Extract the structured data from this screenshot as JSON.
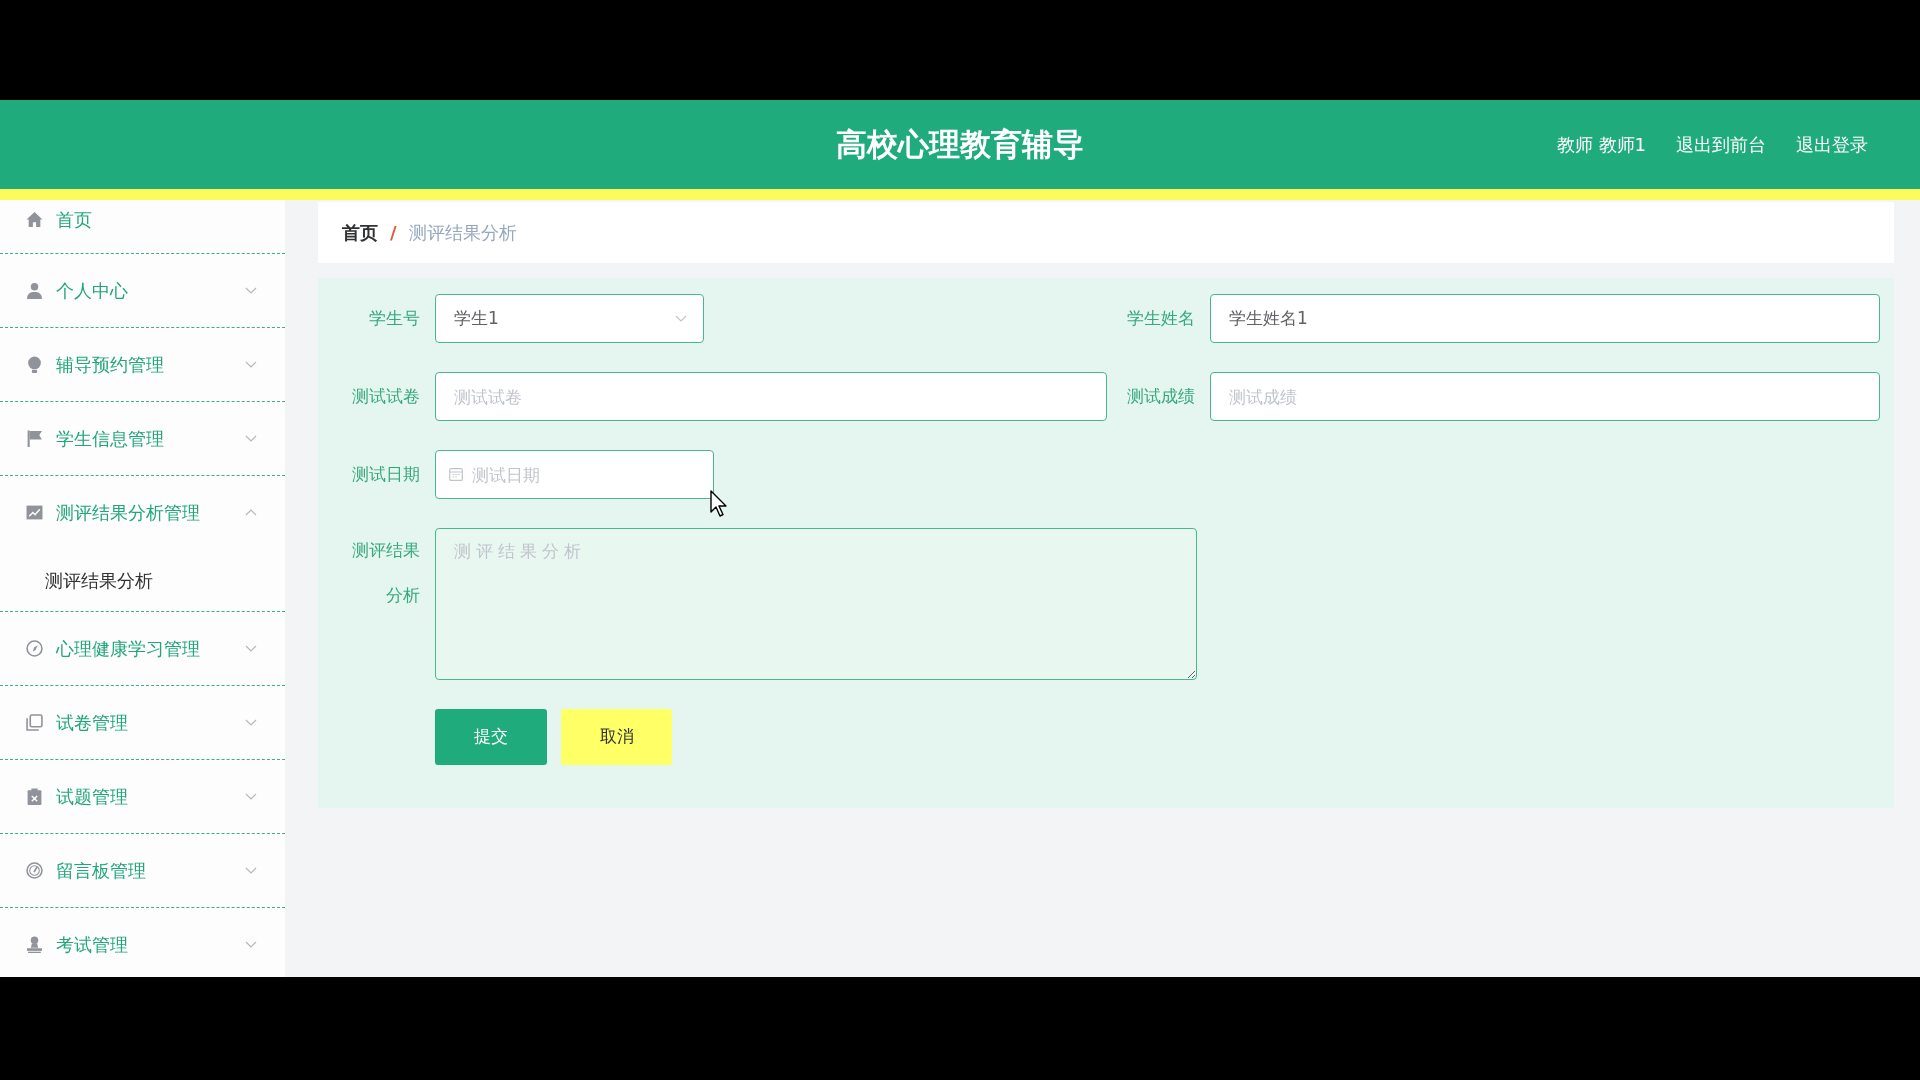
{
  "header": {
    "title": "高校心理教育辅导",
    "user": "教师 教师1",
    "links": [
      {
        "label": "退出到前台"
      },
      {
        "label": "退出登录"
      }
    ]
  },
  "sidebar": {
    "home": {
      "label": "首页"
    },
    "menus": [
      {
        "label": "个人中心",
        "expanded": false
      },
      {
        "label": "辅导预约管理",
        "expanded": false
      },
      {
        "label": "学生信息管理",
        "expanded": false
      },
      {
        "label": "测评结果分析管理",
        "expanded": true,
        "children": [
          {
            "label": "测评结果分析"
          }
        ]
      },
      {
        "label": "心理健康学习管理",
        "expanded": false
      },
      {
        "label": "试卷管理",
        "expanded": false
      },
      {
        "label": "试题管理",
        "expanded": false
      },
      {
        "label": "留言板管理",
        "expanded": false
      },
      {
        "label": "考试管理",
        "expanded": false
      }
    ]
  },
  "breadcrumb": {
    "separator": "/",
    "items": [
      {
        "label": "首页"
      },
      {
        "label": "测评结果分析"
      }
    ]
  },
  "form": {
    "fields": [
      {
        "kind": "select",
        "label": "学生号",
        "value": "学生1"
      },
      {
        "kind": "text",
        "label": "学生姓名",
        "value": "学生姓名1"
      },
      {
        "kind": "text",
        "label": "测试试卷",
        "placeholder": "测试试卷"
      },
      {
        "kind": "text",
        "label": "测试成绩",
        "placeholder": "测试成绩"
      },
      {
        "kind": "date",
        "label": "测试日期",
        "placeholder": "测试日期"
      },
      {
        "kind": "textarea",
        "label": "测评结果分析",
        "placeholder": "测评结果分析"
      }
    ],
    "buttons": [
      {
        "kind": "submit",
        "label": "提交"
      },
      {
        "kind": "cancel",
        "label": "取消"
      }
    ]
  }
}
